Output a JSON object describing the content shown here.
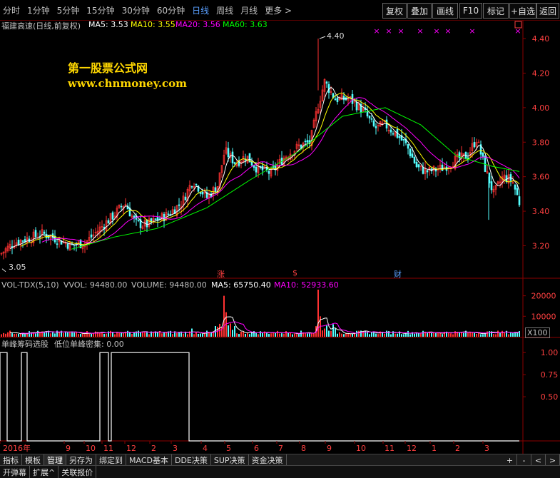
{
  "toolbar": {
    "timeframes": [
      "分时",
      "1分钟",
      "5分钟",
      "15分钟",
      "30分钟",
      "60分钟",
      "日线",
      "周线",
      "月线",
      "更多 >"
    ],
    "active_index": 6,
    "buttons": [
      "复权",
      "叠加",
      "画线",
      "F10",
      "标记",
      "+自选",
      "返回"
    ]
  },
  "main_header": {
    "title": "福建高速(日线,前复权)",
    "ma5": "MA5: 3.53",
    "ma10": "MA10: 3.55",
    "ma20": "MA20: 3.56",
    "ma60": "MA60: 3.63"
  },
  "watermark": {
    "line1": "第一股票公式网",
    "line2": "www.chnmoney.com"
  },
  "price_annotations": {
    "high": "4.40",
    "low": "3.05"
  },
  "event_markers": [
    "涨",
    "$",
    "财"
  ],
  "vol_header": {
    "name": "VOL-TDX(5,10)",
    "vvol": "VVOL: 94480.00",
    "volume": "VOLUME: 94480.00",
    "ma5": "MA5: 65750.40",
    "ma10": "MA10: 52933.60"
  },
  "vol_unit": "X100",
  "ind_header": {
    "name": "单峰筹码选股",
    "value": "低位单峰密集: 0.00"
  },
  "bottom_tabs": [
    "指标",
    "模板",
    "管理",
    "另存为",
    "绑定到",
    "MACD基本",
    "DDE决策",
    "SUP决策",
    "资金决策"
  ],
  "bottom_active_index": 2,
  "bottom_tabs2": [
    "开弹幕",
    "扩展^",
    "关联报价"
  ],
  "bottom_right": [
    "+",
    "-",
    "<",
    ">"
  ],
  "colors": {
    "up": "#ff3232",
    "down": "#54ffff",
    "ma5": "#ffffff",
    "ma10": "#ffff00",
    "ma20": "#ff00ff",
    "ma60": "#00ff00",
    "frame": "#8b0000",
    "axis_text": "#ff4040"
  },
  "chart_data": [
    {
      "type": "candlestick",
      "title": "福建高速(日线,前复权)",
      "y_ticks": [
        3.2,
        3.4,
        3.6,
        3.8,
        4.0,
        4.2,
        4.4
      ],
      "ylim": [
        3.02,
        4.45
      ],
      "x_tick_labels": [
        "2016年",
        "9",
        "10",
        "11",
        "12",
        "2",
        "3",
        "4",
        "5",
        "6",
        "7",
        "8",
        "9",
        "10",
        "11",
        "12",
        "1",
        "2",
        "3"
      ],
      "close_path_approx": [
        [
          0,
          3.15
        ],
        [
          20,
          3.22
        ],
        [
          45,
          3.25
        ],
        [
          60,
          3.27
        ],
        [
          80,
          3.24
        ],
        [
          100,
          3.2
        ],
        [
          120,
          3.22
        ],
        [
          140,
          3.3
        ],
        [
          160,
          3.38
        ],
        [
          175,
          3.45
        ],
        [
          190,
          3.33
        ],
        [
          205,
          3.32
        ],
        [
          220,
          3.35
        ],
        [
          235,
          3.38
        ],
        [
          255,
          3.45
        ],
        [
          270,
          3.58
        ],
        [
          290,
          3.48
        ],
        [
          305,
          3.55
        ],
        [
          315,
          3.75
        ],
        [
          330,
          3.68
        ],
        [
          345,
          3.72
        ],
        [
          360,
          3.65
        ],
        [
          380,
          3.62
        ],
        [
          400,
          3.72
        ],
        [
          420,
          3.78
        ],
        [
          435,
          3.8
        ],
        [
          445,
          4.0
        ],
        [
          455,
          4.15
        ],
        [
          470,
          4.05
        ],
        [
          490,
          4.05
        ],
        [
          510,
          3.98
        ],
        [
          525,
          3.88
        ],
        [
          540,
          3.9
        ],
        [
          555,
          3.85
        ],
        [
          570,
          3.78
        ],
        [
          585,
          3.65
        ],
        [
          600,
          3.63
        ],
        [
          620,
          3.65
        ],
        [
          640,
          3.7
        ],
        [
          655,
          3.72
        ],
        [
          668,
          3.82
        ],
        [
          680,
          3.65
        ],
        [
          692,
          3.5
        ],
        [
          705,
          3.6
        ],
        [
          718,
          3.58
        ],
        [
          728,
          3.45
        ]
      ],
      "high": 4.4,
      "low": 3.05,
      "ma60_path_approx": [
        [
          100,
          3.18
        ],
        [
          160,
          3.25
        ],
        [
          220,
          3.3
        ],
        [
          290,
          3.42
        ],
        [
          350,
          3.58
        ],
        [
          420,
          3.75
        ],
        [
          480,
          3.95
        ],
        [
          540,
          4.0
        ],
        [
          590,
          3.9
        ],
        [
          640,
          3.72
        ],
        [
          690,
          3.66
        ],
        [
          728,
          3.63
        ]
      ]
    },
    {
      "type": "bar",
      "title": "VOL-TDX(5,10)",
      "y_ticks": [
        10000,
        20000
      ],
      "ylim": [
        0,
        23000
      ],
      "spikes": [
        [
          313,
          20000
        ],
        [
          446,
          23000
        ],
        [
          318,
          12000
        ],
        [
          448,
          10000
        ],
        [
          270,
          4000
        ],
        [
          470,
          4000
        ]
      ]
    },
    {
      "type": "line",
      "title": "单峰筹码选股",
      "y_ticks": [
        0.5,
        0.75,
        1.0
      ],
      "ylim": [
        0,
        1.05
      ],
      "segments_high": [
        [
          0,
          10
        ],
        [
          30,
          38
        ],
        [
          140,
          152
        ],
        [
          156,
          265
        ]
      ],
      "value": 0.0
    }
  ]
}
